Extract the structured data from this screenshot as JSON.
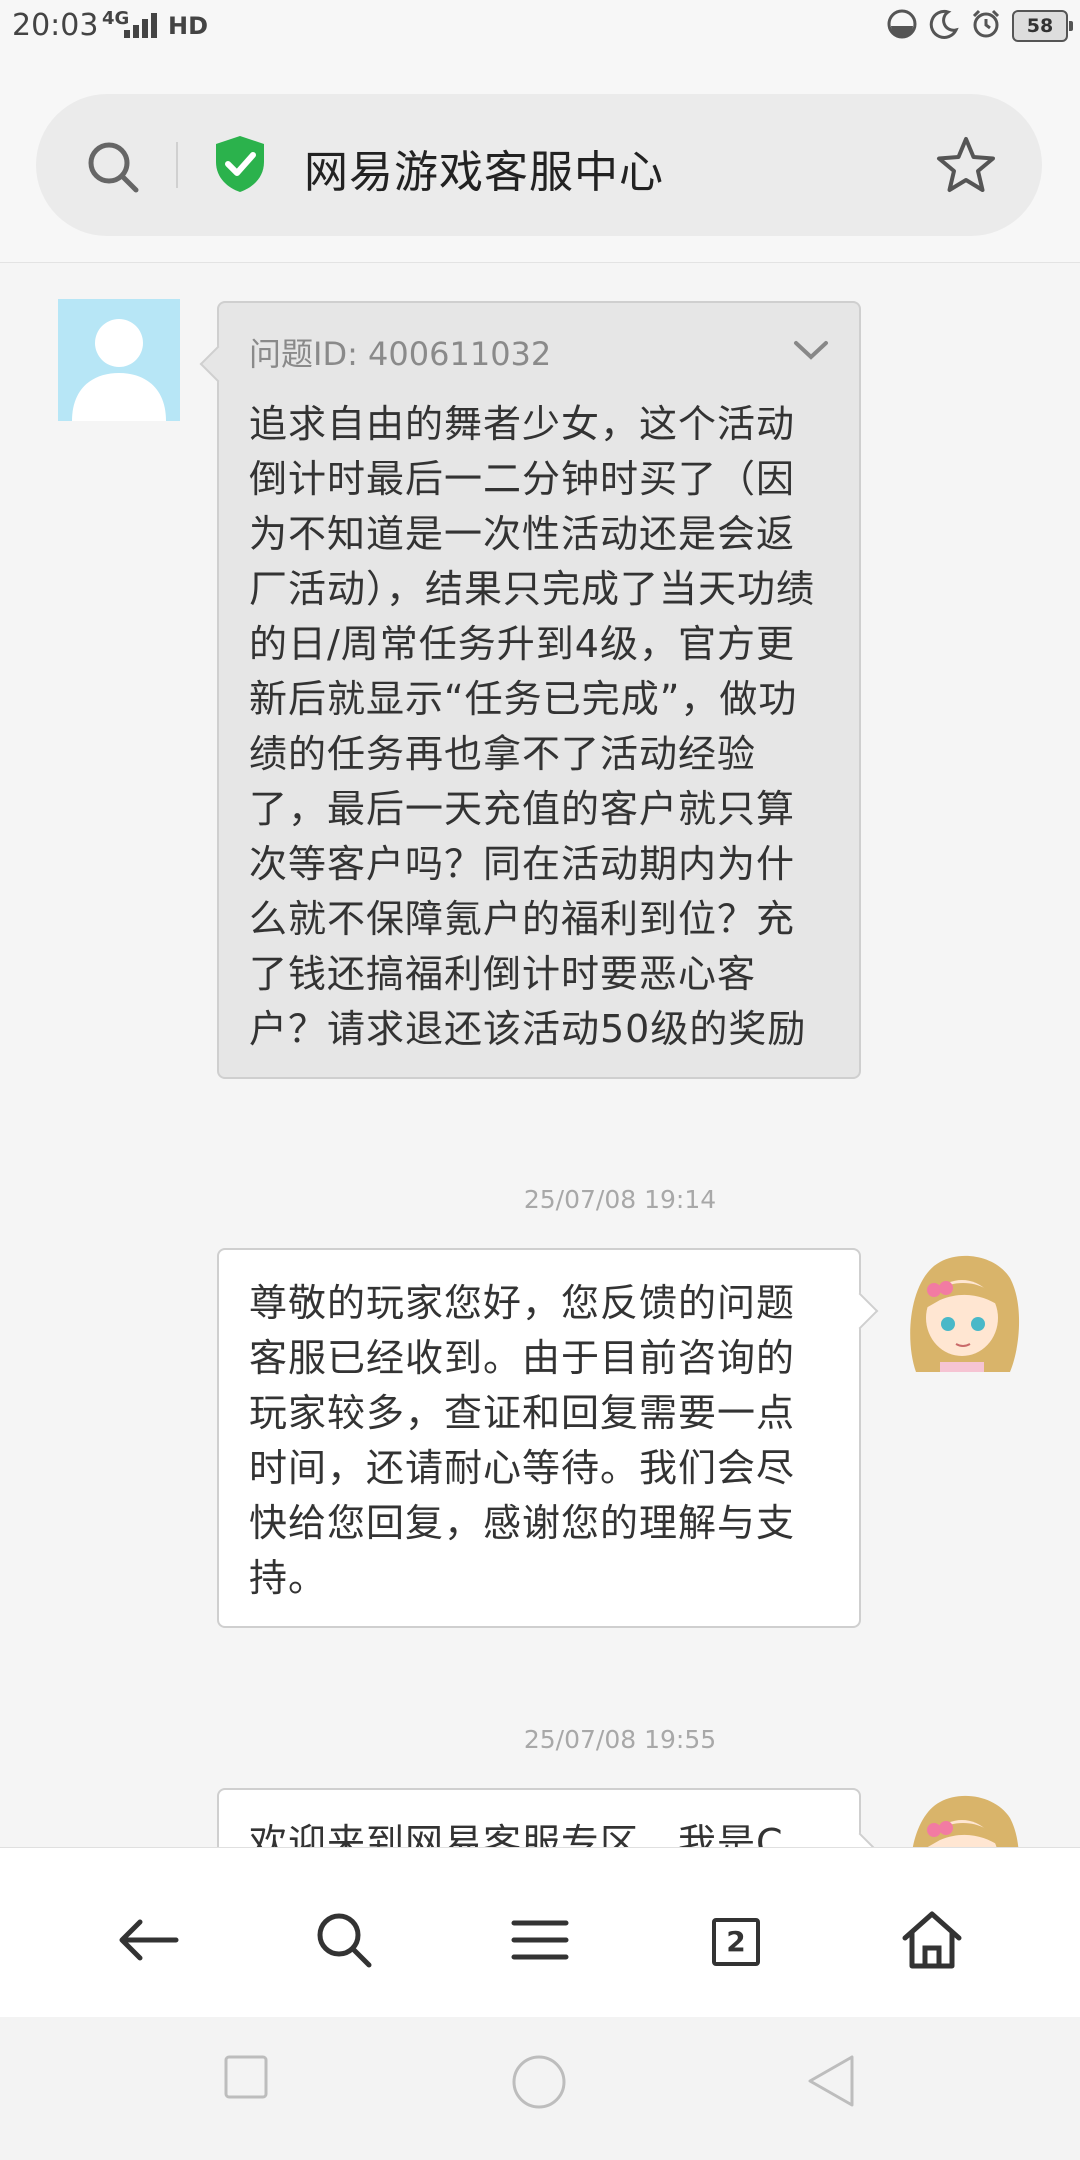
{
  "status_bar": {
    "time": "20:03",
    "network": "4G",
    "hd": "HD",
    "battery": "58"
  },
  "address_bar": {
    "title": "网易游戏客服中心"
  },
  "conversation": {
    "user_message": {
      "question_id": "问题ID: 400611032",
      "text": "追求自由的舞者少女，这个活动倒计时最后一二分钟时买了（因为不知道是一次性活动还是会返厂活动），结果只完成了当天功绩的日/周常任务升到4级，官方更新后就显示“任务已完成”，做功绩的任务再也拿不了活动经验了，最后一天充值的客户就只算次等客户吗？同在活动期内为什么就不保障氪户的福利到位？充了钱还搞福利倒计时要恶心客户？请求退还该活动50级的奖励"
    },
    "reply_1": {
      "timestamp": "25/07/08 19:14",
      "text": "尊敬的玩家您好，您反馈的问题客服已经收到。由于目前咨询的玩家较多，查证和回复需要一点时间，还请耐心等待。我们会尽快给您回复，感谢您的理解与支持。"
    },
    "reply_2": {
      "timestamp": "25/07/08 19:55",
      "text": "欢迎来到网易客服专区，我是C"
    }
  },
  "toolbar": {
    "tab_count": "2"
  },
  "colors": {
    "shield": "#2bb24c",
    "user_bubble": "#e6e6e6",
    "agent_bubble": "#ffffff",
    "avatar_bg": "#b7e6f6"
  }
}
